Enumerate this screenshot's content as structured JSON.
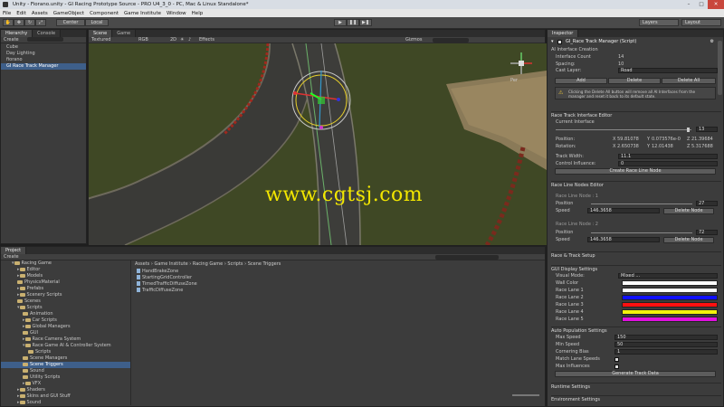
{
  "window": {
    "title": "Unity - Fiorano.unity - GI Racing Prototype Source - PRO U4_3_0 - PC, Mac & Linux Standalone*",
    "controls": [
      "–",
      "□",
      "✕"
    ]
  },
  "menu": [
    "File",
    "Edit",
    "Assets",
    "GameObject",
    "Component",
    "Game Institute",
    "Window",
    "Help"
  ],
  "toolbar": {
    "pivot": "Center",
    "space": "Local",
    "play": "▶",
    "pause": "❚❚",
    "step": "▶❚",
    "layers": "Layers",
    "layout": "Layout"
  },
  "hierarchy": {
    "tabs": [
      "Hierarchy",
      "Console"
    ],
    "create": "Create",
    "items": [
      "Cube",
      "Day Lighting",
      "fiorano",
      "GI Race Track Manager"
    ]
  },
  "scene": {
    "tabs": [
      "Scene",
      "Game"
    ],
    "shading": "Textured",
    "render": "RGB",
    "mode_2d": "2D",
    "effects": "Effects",
    "gizmos": "Gizmos",
    "persp": "Per",
    "watermark": "www.cgtsj.com",
    "colors": {
      "grass": "#3a4422",
      "road": "#3b3b38",
      "watermark": "#f2e600"
    }
  },
  "inspector": {
    "tab": "Inspector",
    "component": "GI_Race Track Manager (Script)",
    "ai_section": "AI Interface Creation",
    "interface_count_label": "Interface Count",
    "interface_count": "14",
    "spacing_label": "Spacing:",
    "spacing": "10",
    "cast_layer_label": "Cast Layer:",
    "cast_layer": "Road",
    "add": "Add",
    "delete": "Delete",
    "delete_all": "Delete All",
    "warning": "Clicking the Delete All button will remove all AI Interfaces from the manager and reset it back to its default state.",
    "interface_editor": "Race Track Interface Editor",
    "current_interface": "Current Interface",
    "current_value": "13",
    "position_label": "Position:",
    "position": {
      "x": "59.81078",
      "y": "0.073576e-0",
      "z": "21.39684"
    },
    "rotation_label": "Rotation:",
    "rotation": {
      "x": "2.650738",
      "y": "12.01438",
      "z": "5.317688"
    },
    "track_width_label": "Track Width:",
    "track_width": "11.1",
    "control_influence_label": "Control Influence:",
    "control_influence": "0",
    "create_race_line": "Create Race Line Node",
    "nodes_editor": "Race Line Nodes Editor",
    "node1_title": "Race Line Node : 1",
    "node2_title": "Race Line Node : 2",
    "position_word": "Position",
    "speed_word": "Speed",
    "node1_position": "27",
    "node1_speed": "146.3658",
    "node2_position": "72",
    "node2_speed": "146.3658",
    "delete_node": "Delete Node",
    "track_setup": "Race & Track Setup",
    "gui_display": "GUI Display Settings",
    "visual_mode_label": "Visual Mode:",
    "visual_mode": "Mixed ...",
    "wall_color_label": "Wall Color",
    "lanes": [
      {
        "label": "Race Lane 1",
        "color": "#ffffff"
      },
      {
        "label": "Race Lane 2",
        "color": "#1010ff"
      },
      {
        "label": "Race Lane 3",
        "color": "#ff1010"
      },
      {
        "label": "Race Lane 4",
        "color": "#f2f20c"
      },
      {
        "label": "Race Lane 5",
        "color": "#e010e0"
      }
    ],
    "wall_color": "#ffffff",
    "auto_population": "Auto Population Settings",
    "max_speed_label": "Max Speed",
    "max_speed": "150",
    "min_speed_label": "Min Speed",
    "min_speed": "50",
    "cornering_bias_label": "Cornering Bias",
    "cornering_bias": "1",
    "match_lane_label": "Match Lane Speeds",
    "max_influences_label": "Max Influences",
    "generate": "Generate Track Data",
    "runtime": "Runtime Settings",
    "environment": "Environment Settings"
  },
  "project": {
    "tab": "Project",
    "create": "Create",
    "breadcrumb": "Assets › Game Institute › Racing Game › Scripts › Scene Triggers",
    "tree": [
      "Racing Game",
      "Editor",
      "Models",
      "PhysicsMaterial",
      "Prefabs",
      "Scenery Scripts",
      "Scenes",
      "Scripts",
      "Animation",
      "Car Scripts",
      "Global Managers",
      "GUI",
      "Race Camera System",
      "Race Game AI & Controller System",
      "Scripts",
      "Scene Managers",
      "Scene Triggers",
      "Sound",
      "Utility Scripts",
      "VFX",
      "Shaders",
      "Skins and GUI Stuff",
      "Sound"
    ],
    "files": [
      "HandBrakeZone",
      "StartingGridController",
      "TimedTrafficDiffuseZone",
      "TrafficDiffuseZone"
    ]
  }
}
